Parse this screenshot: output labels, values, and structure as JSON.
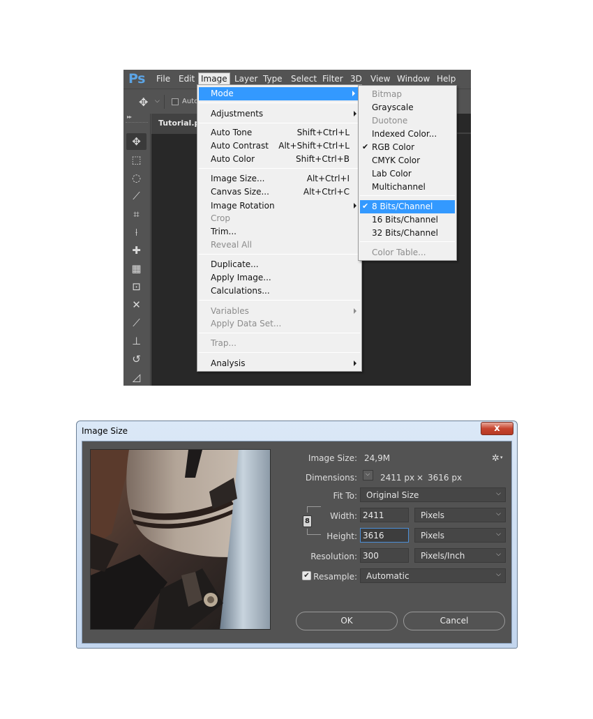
{
  "photoshop": {
    "logo": "Ps",
    "menubar": [
      "File",
      "Edit",
      "Image",
      "Layer",
      "Type",
      "Select",
      "Filter",
      "3D",
      "View",
      "Window",
      "Help"
    ],
    "options_bar": {
      "auto_label": "Auto"
    },
    "doc_tab": "Tutorial.ps",
    "tools": [
      "move-icon",
      "marquee-icon",
      "lasso-icon",
      "quick-select-icon",
      "crop-icon",
      "eyedropper-icon",
      "healing-brush-icon",
      "patch-icon",
      "content-aware-move-icon",
      "warp-icon",
      "brush-icon",
      "clone-stamp-icon",
      "history-brush-icon",
      "eraser-icon"
    ],
    "image_menu": {
      "mode": "Mode",
      "adjustments": "Adjustments",
      "auto_tone": "Auto Tone",
      "auto_tone_sc": "Shift+Ctrl+L",
      "auto_contrast": "Auto Contrast",
      "auto_contrast_sc": "Alt+Shift+Ctrl+L",
      "auto_color": "Auto Color",
      "auto_color_sc": "Shift+Ctrl+B",
      "image_size": "Image Size...",
      "image_size_sc": "Alt+Ctrl+I",
      "canvas_size": "Canvas Size...",
      "canvas_size_sc": "Alt+Ctrl+C",
      "image_rotation": "Image Rotation",
      "crop": "Crop",
      "trim": "Trim...",
      "reveal_all": "Reveal All",
      "duplicate": "Duplicate...",
      "apply_image": "Apply Image...",
      "calculations": "Calculations...",
      "variables": "Variables",
      "apply_data_set": "Apply Data Set...",
      "trap": "Trap...",
      "analysis": "Analysis"
    },
    "mode_submenu": {
      "bitmap": "Bitmap",
      "grayscale": "Grayscale",
      "duotone": "Duotone",
      "indexed": "Indexed Color...",
      "rgb": "RGB Color",
      "cmyk": "CMYK Color",
      "lab": "Lab Color",
      "multichannel": "Multichannel",
      "bits8": "8 Bits/Channel",
      "bits16": "16 Bits/Channel",
      "bits32": "32 Bits/Channel",
      "color_table": "Color Table...",
      "checkmark": "✔"
    }
  },
  "dialog": {
    "title": "Image Size",
    "close": "x",
    "image_size_label": "Image Size:",
    "image_size_value": "24,9M",
    "dimensions_label": "Dimensions:",
    "dim_width": "2411 px",
    "dim_x": "×",
    "dim_height": "3616 px",
    "fit_to_label": "Fit To:",
    "fit_to_value": "Original Size",
    "width_label": "Width:",
    "width_value": "2411",
    "width_unit": "Pixels",
    "height_label": "Height:",
    "height_value": "3616",
    "height_unit": "Pixels",
    "resolution_label": "Resolution:",
    "resolution_value": "300",
    "resolution_unit": "Pixels/Inch",
    "resample_label": "Resample:",
    "resample_value": "Automatic",
    "resample_checked": "✔",
    "ok": "OK",
    "cancel": "Cancel"
  }
}
